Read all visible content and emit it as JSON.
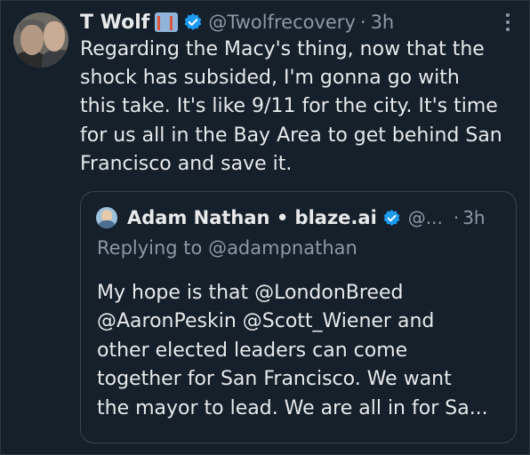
{
  "tweet": {
    "author_name": "T Wolf",
    "handle": "@Twolfrecovery",
    "separator": "·",
    "time": "3h",
    "text_lines": [
      "Regarding the Macy's thing, now that the",
      "shock has subsided, I'm gonna go with",
      "this take. It's like 9/11 for the city. It's time",
      "for us all in the Bay Area to get behind San",
      "Francisco and save it."
    ]
  },
  "quoted_tweet": {
    "author_name": "Adam Nathan • blaze.ai",
    "handle": "@...",
    "separator": "·",
    "time": "3h",
    "replying_to": "Replying to @adampnathan",
    "text_lines": [
      "My hope is that @LondonBreed",
      "@AaronPeskin @Scott_Wiener and",
      "other elected leaders can come",
      "together for San Francisco. We want",
      "the mayor to lead. We are all in for Sa..."
    ]
  },
  "colors": {
    "background": "#15202b",
    "text_primary": "#e7e9ea",
    "text_secondary": "#8b98a5",
    "verified_blue": "#1d9bf0",
    "border": "#38444d"
  },
  "icons": {
    "verified": "verified-badge-icon",
    "more": "more-options-icon",
    "flag": "golden-gate-flag-icon"
  }
}
